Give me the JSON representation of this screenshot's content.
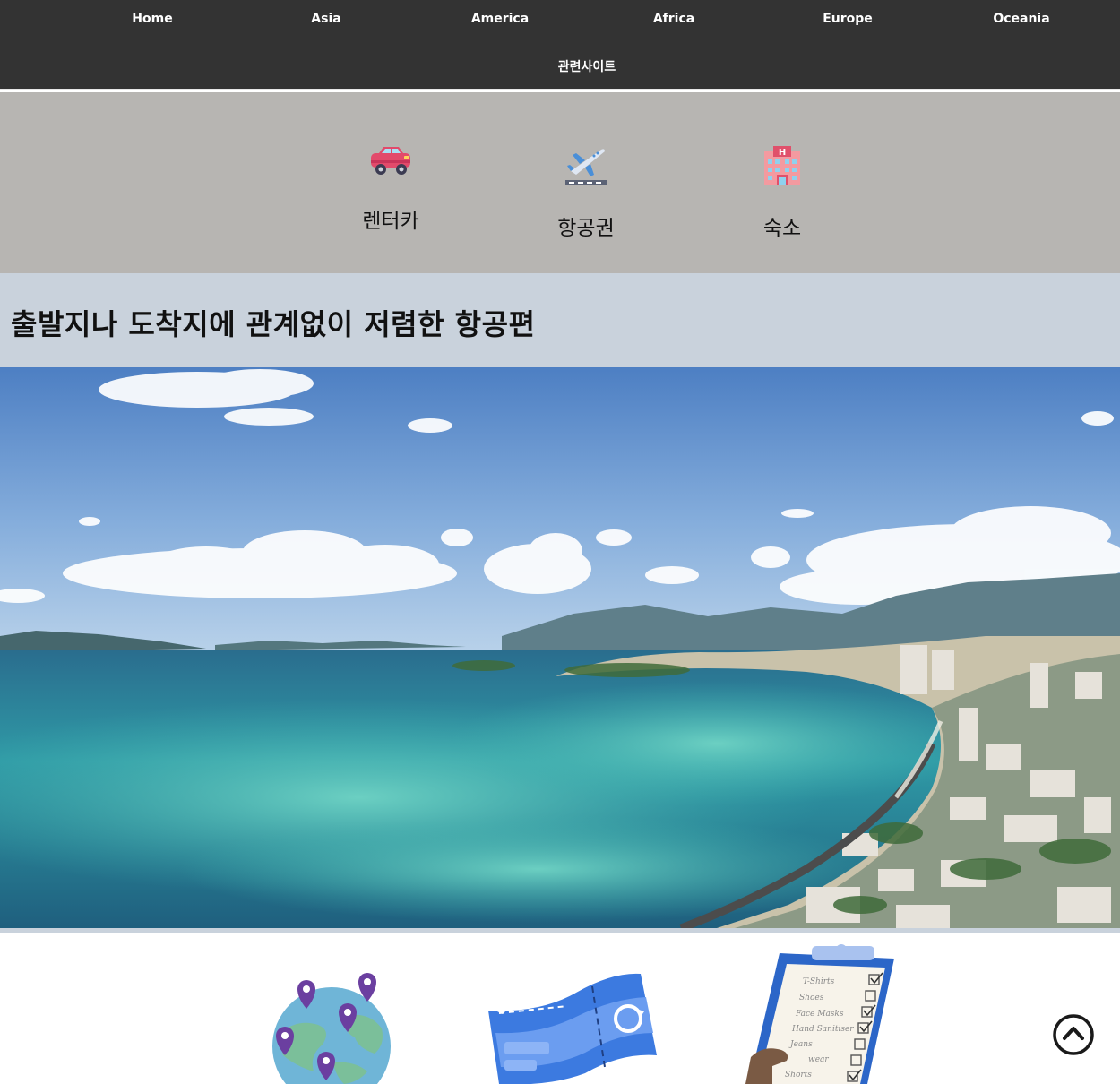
{
  "nav": {
    "items": [
      {
        "label": "Home"
      },
      {
        "label": "Asia"
      },
      {
        "label": "America"
      },
      {
        "label": "Africa"
      },
      {
        "label": "Europe"
      },
      {
        "label": "Oceania"
      },
      {
        "label": "관련사이트"
      }
    ],
    "background": "#333333"
  },
  "quick_links": {
    "items": [
      {
        "label": "렌터카",
        "icon": "car-icon"
      },
      {
        "label": "항공권",
        "icon": "airplane-icon"
      },
      {
        "label": "숙소",
        "icon": "hotel-icon"
      }
    ],
    "background": "#b7b5b2"
  },
  "headline": {
    "text": "출발지나 도착지에 관계없이 저렴한 항공편",
    "background": "#c9d2dc"
  },
  "hero": {
    "image": "coastal-city-beach-photo"
  },
  "features": {
    "icons": [
      "globe-with-pins-icon",
      "flight-ticket-icon",
      "packing-checklist-icon"
    ],
    "checklist_items": [
      "T-Shirts",
      "Shoes",
      "Face Masks",
      "Hand Sanitiser",
      "Jeans",
      "wear",
      "Shorts"
    ]
  },
  "scroll_top": {
    "icon": "chevron-up-circle-icon"
  }
}
